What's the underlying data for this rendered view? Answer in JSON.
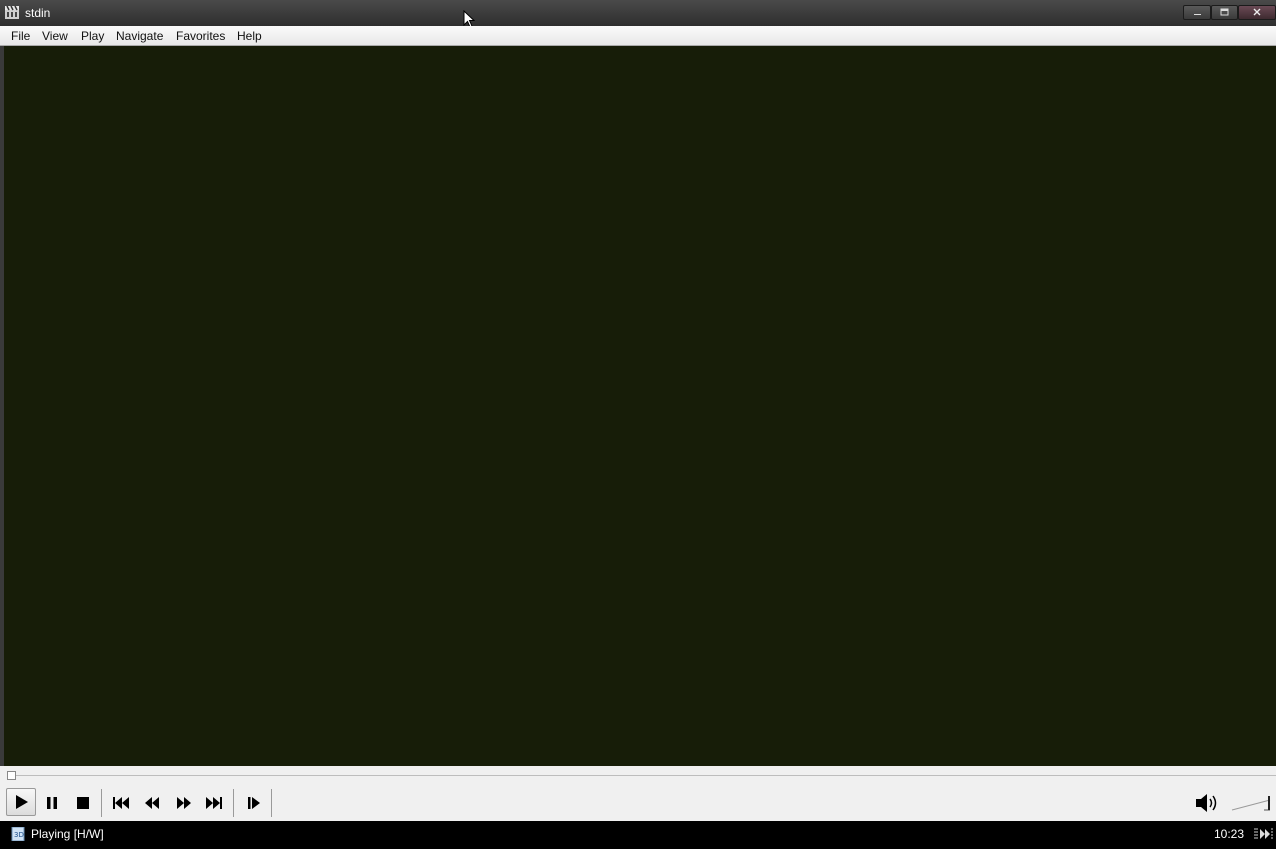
{
  "window": {
    "title": "stdin",
    "icon": "film-clapper-icon"
  },
  "menubar": {
    "items": [
      "File",
      "View",
      "Play",
      "Navigate",
      "Favorites",
      "Help"
    ]
  },
  "controls": {
    "buttons": [
      "play",
      "pause",
      "stop",
      "skip-back",
      "rewind",
      "fast-forward",
      "skip-forward",
      "frame-step"
    ],
    "volume_icon": "speaker-icon"
  },
  "seek": {
    "position_fraction": 0
  },
  "statusbar": {
    "status": "Playing [H/W]",
    "time": "10:23"
  },
  "colors": {
    "video_background": "#171d08",
    "statusbar_background": "#000000",
    "titlebar_background": "#3a3a3a"
  }
}
